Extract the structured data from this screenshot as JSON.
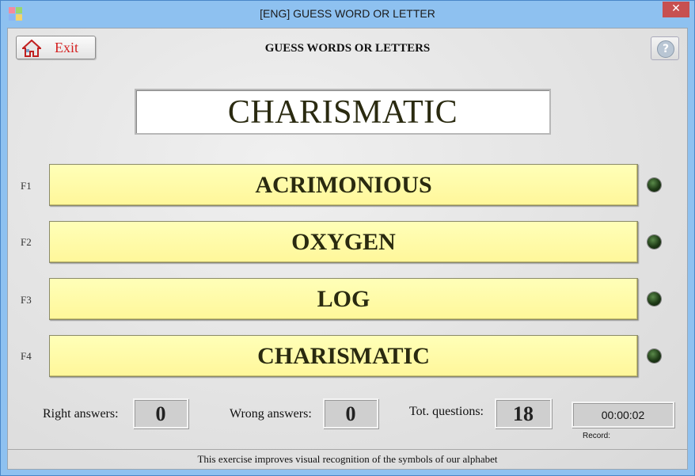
{
  "window": {
    "title": "[ENG] GUESS WORD OR LETTER",
    "close_glyph": "✕"
  },
  "toolbar": {
    "exit_label": "Exit",
    "header_title": "GUESS WORDS OR LETTERS",
    "help_glyph": "?"
  },
  "target_word": "CHARISMATIC",
  "answers": [
    {
      "key": "F1",
      "label": "ACRIMONIOUS"
    },
    {
      "key": "F2",
      "label": "OXYGEN"
    },
    {
      "key": "F3",
      "label": "LOG"
    },
    {
      "key": "F4",
      "label": "CHARISMATIC"
    }
  ],
  "stats": {
    "right_label": "Right answers:",
    "right_value": "0",
    "wrong_label": "Wrong answers:",
    "wrong_value": "0",
    "total_label": "Tot. questions:",
    "total_value": "18",
    "timer": "00:00:02",
    "record_label": "Record:"
  },
  "status_text": "This exercise improves visual recognition of the symbols of our alphabet",
  "colors": {
    "answer_fill": "#fff79a",
    "led_off": "#1e3a16",
    "exit_text": "#d42020",
    "titlebar": "#8ec1f0"
  },
  "icons": {
    "app": "app-icon",
    "exit": "home-icon",
    "help": "help-icon",
    "close": "close-icon"
  }
}
